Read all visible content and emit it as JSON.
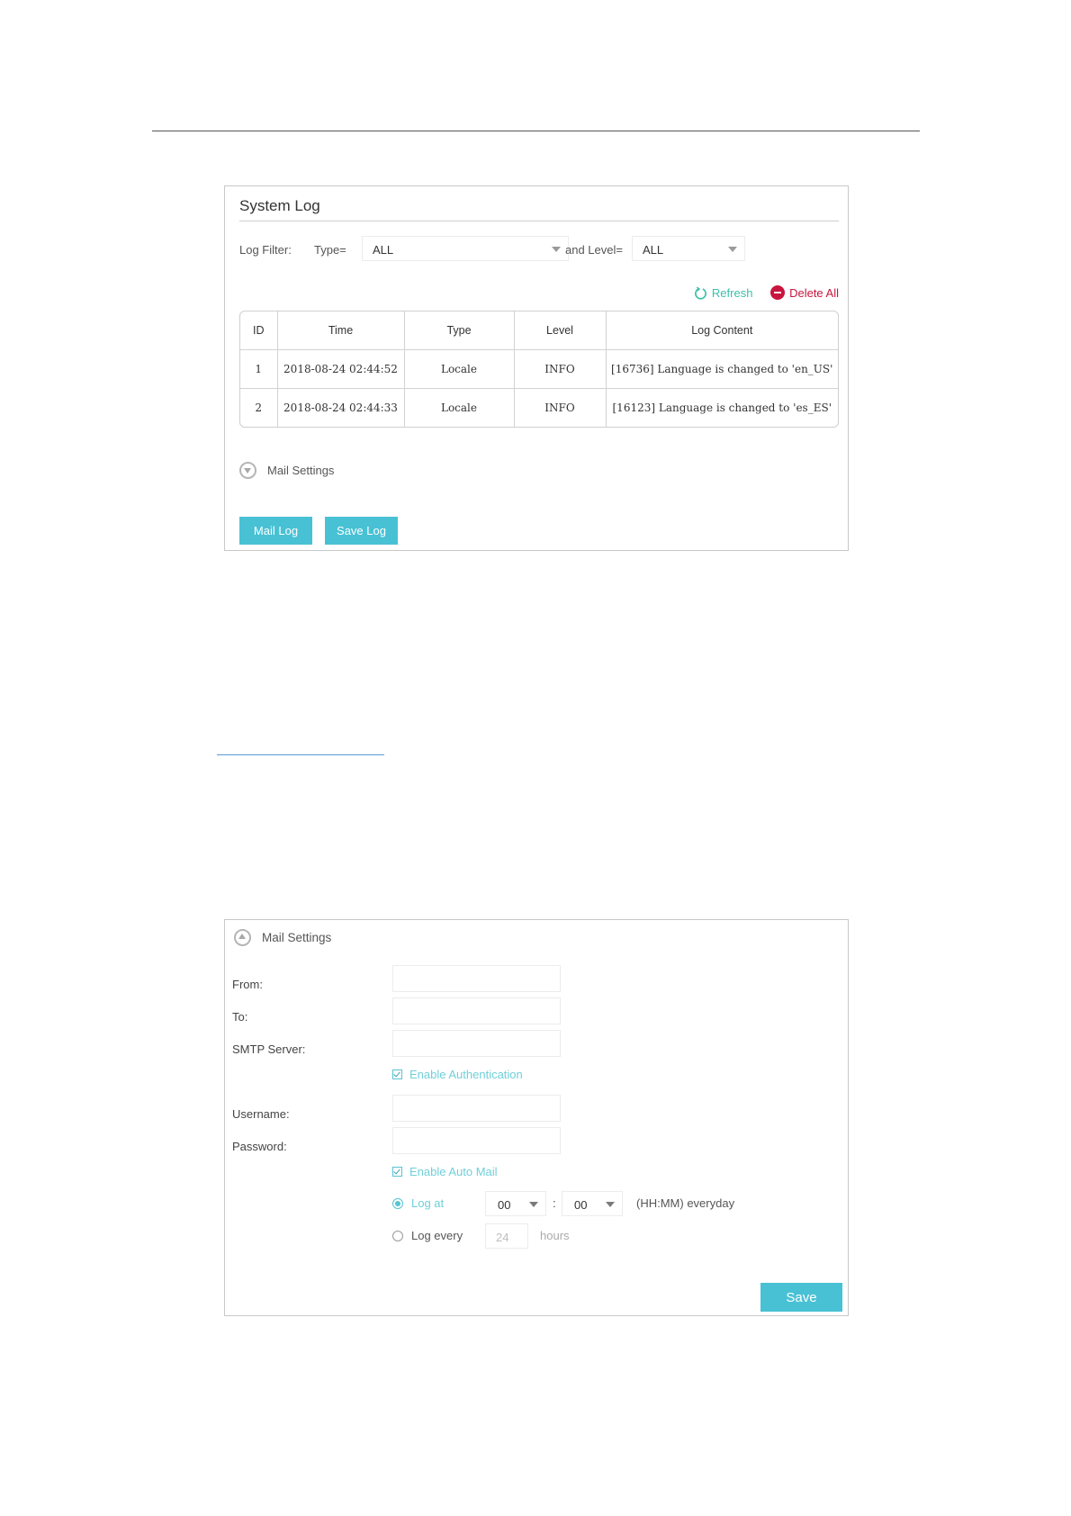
{
  "system_log": {
    "title": "System Log",
    "filter": {
      "label": "Log Filter:",
      "type_label": "Type=",
      "type_value": "ALL",
      "level_label": "and Level=",
      "level_value": "ALL"
    },
    "actions": {
      "refresh": "Refresh",
      "delete_all": "Delete All"
    },
    "table": {
      "headers": [
        "ID",
        "Time",
        "Type",
        "Level",
        "Log Content"
      ],
      "rows": [
        [
          "1",
          "2018-08-24 02:44:52",
          "Locale",
          "INFO",
          "[16736] Language is changed to 'en_US'"
        ],
        [
          "2",
          "2018-08-24 02:44:33",
          "Locale",
          "INFO",
          "[16123] Language is changed to 'es_ES'"
        ]
      ]
    },
    "mail_settings_label": "Mail Settings",
    "buttons": {
      "mail_log": "Mail Log",
      "save_log": "Save Log"
    }
  },
  "mail_settings": {
    "title": "Mail Settings",
    "labels": {
      "from": "From:",
      "to": "To:",
      "smtp": "SMTP Server:",
      "username": "Username:",
      "password": "Password:"
    },
    "enable_auth": "Enable Authentication",
    "enable_auto_mail": "Enable Auto Mail",
    "log_at": {
      "label": "Log at",
      "hour": "00",
      "colon": ":",
      "minute": "00",
      "suffix": "(HH:MM) everyday"
    },
    "log_every": {
      "label": "Log every",
      "value": "24",
      "unit": "hours"
    },
    "save": "Save"
  },
  "colors": {
    "accent": "#48c1d4",
    "refresh": "#3dbfaa",
    "danger": "#c8163e"
  }
}
